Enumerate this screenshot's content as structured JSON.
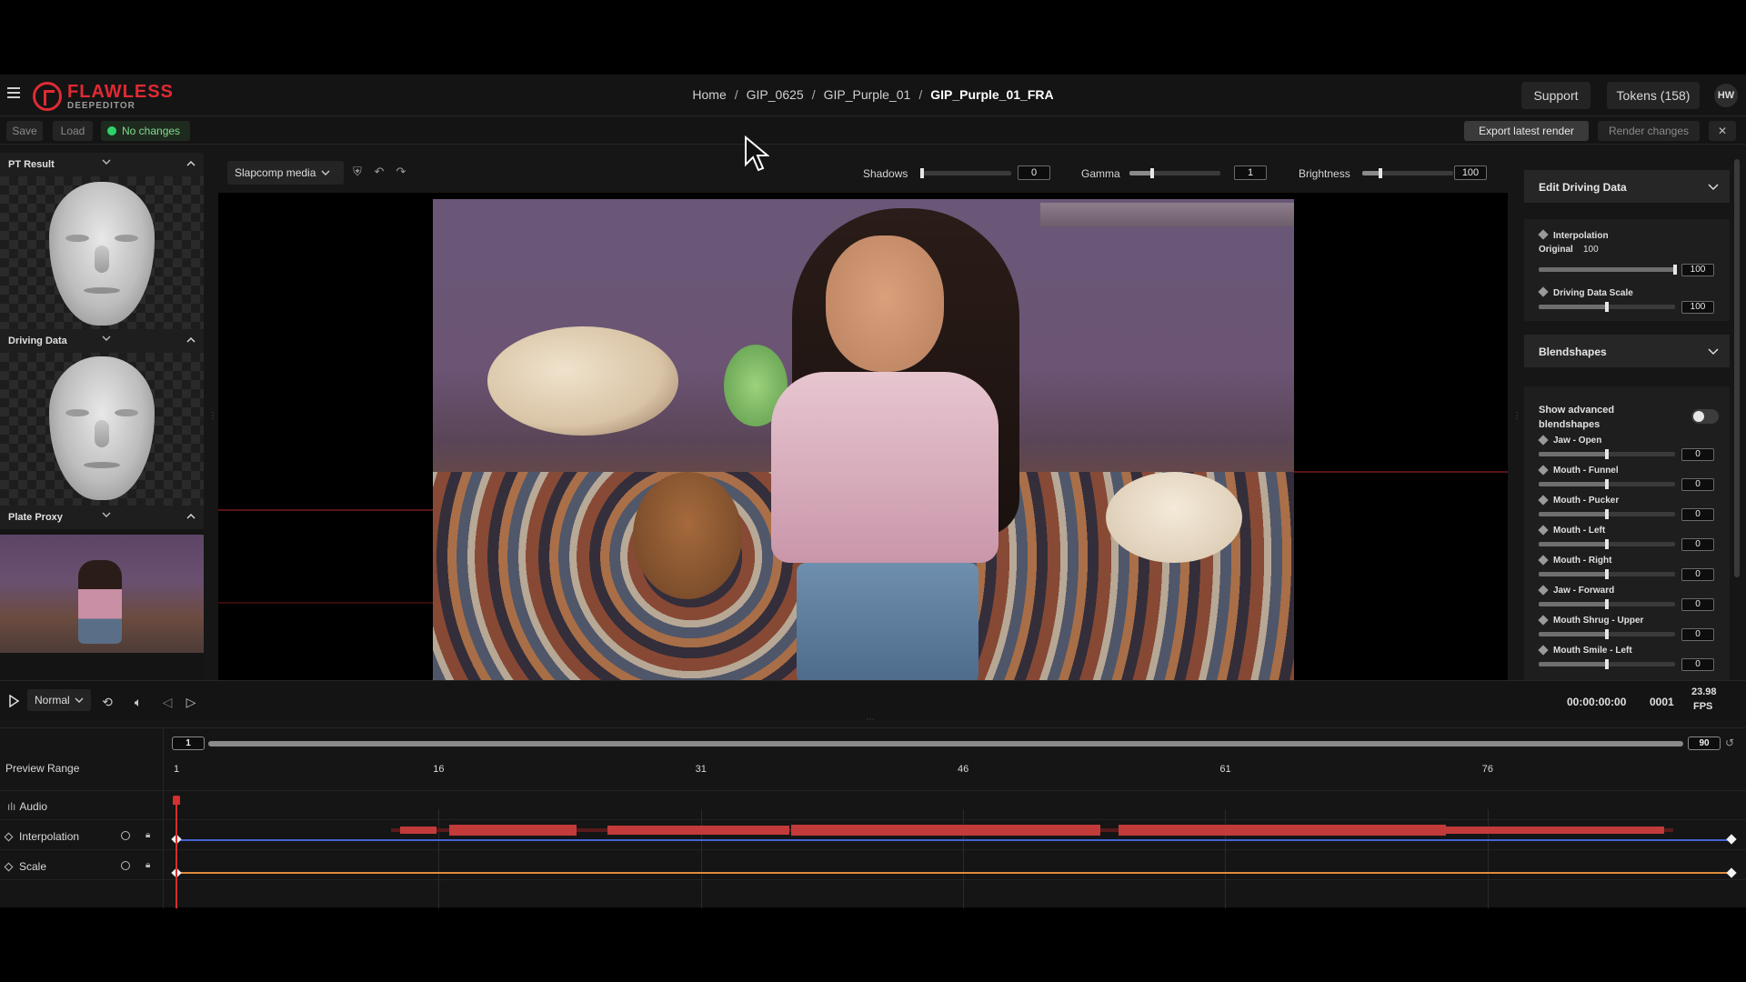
{
  "app": {
    "logo_title": "FLAWLESS",
    "logo_subtitle": "DEEPEDITOR",
    "accent_color": "#e02a34"
  },
  "breadcrumb": [
    "Home",
    "GIP_0625",
    "GIP_Purple_01",
    "GIP_Purple_01_FRA"
  ],
  "header": {
    "support_label": "Support",
    "tokens_label": "Tokens (158)",
    "avatar_initials": "HW"
  },
  "actions": {
    "save_label": "Save",
    "load_label": "Load",
    "status_label": "No changes",
    "export_label": "Export latest render",
    "render_label": "Render changes",
    "close_icon": "close-icon"
  },
  "left_panels": [
    {
      "title": "PT Result"
    },
    {
      "title": "Driving Data"
    },
    {
      "title": "Plate Proxy"
    }
  ],
  "viewer": {
    "media_select": "Slapcomp media",
    "shadows_label": "Shadows",
    "shadows_value": "0",
    "shadows_level": 0.0,
    "gamma_label": "Gamma",
    "gamma_value": "1",
    "gamma_level": 0.25,
    "brightness_label": "Brightness",
    "brightness_value": "100",
    "brightness_level": 0.2
  },
  "edit_driving": {
    "title": "Edit Driving Data",
    "interpolation_label": "Interpolation",
    "original_label": "Original",
    "original_value": "100",
    "interpolation_value": "100",
    "interpolation_level": 1.0,
    "scale_label": "Driving Data Scale",
    "scale_value": "100",
    "scale_level": 0.5
  },
  "blendshapes": {
    "title": "Blendshapes",
    "advanced_label_1": "Show advanced",
    "advanced_label_2": "blendshapes",
    "advanced_on": false,
    "items": [
      {
        "label": "Jaw - Open",
        "value": "0"
      },
      {
        "label": "Mouth - Funnel",
        "value": "0"
      },
      {
        "label": "Mouth - Pucker",
        "value": "0"
      },
      {
        "label": "Mouth - Left",
        "value": "0"
      },
      {
        "label": "Mouth - Right",
        "value": "0"
      },
      {
        "label": "Jaw - Forward",
        "value": "0"
      },
      {
        "label": "Mouth Shrug - Upper",
        "value": "0"
      },
      {
        "label": "Mouth Smile - Left",
        "value": "0"
      }
    ]
  },
  "transport": {
    "speed_label": "Normal",
    "timecode": "00:00:00:00",
    "frame": "0001",
    "fps_value": "23.98",
    "fps_label": "FPS"
  },
  "timeline": {
    "preview_range_label": "Preview Range",
    "range_start": "1",
    "range_end": "90",
    "ticks": [
      "1",
      "16",
      "31",
      "46",
      "61",
      "76"
    ],
    "tracks": [
      {
        "label": "Audio"
      },
      {
        "label": "Interpolation"
      },
      {
        "label": "Scale"
      }
    ],
    "interpolation_color": "#4363d6",
    "scale_color": "#e08a3a",
    "playhead_color": "#d43030"
  }
}
